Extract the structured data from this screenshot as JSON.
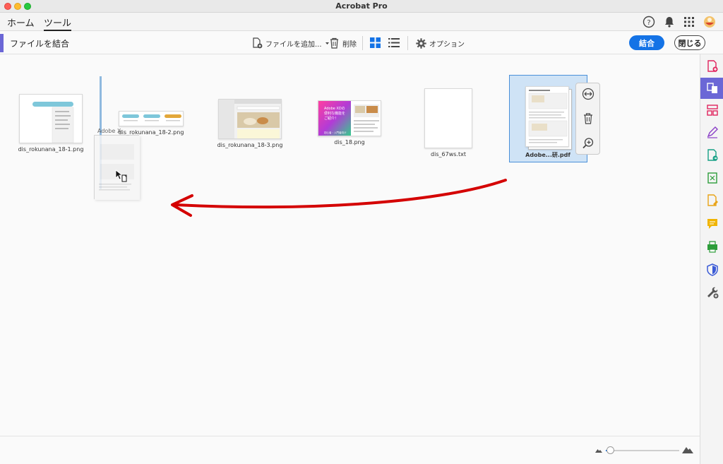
{
  "window": {
    "title": "Acrobat Pro"
  },
  "tabs": [
    {
      "label": "ホーム"
    },
    {
      "label": "ツール"
    }
  ],
  "toolbar": {
    "title": "ファイルを結合",
    "add_files_label": "ファイルを追加...",
    "delete_label": "削除",
    "options_label": "オプション",
    "combine_label": "結合",
    "close_label": "閉じる"
  },
  "thumbnail_text": {
    "xd_line1": "Adobe XDの",
    "xd_line2": "便利な機能を",
    "xd_line3": "ご紹介！",
    "xd_footer": "初心者・入門者向け"
  },
  "files": [
    {
      "name": "dis_rokunana_18-1.png"
    },
    {
      "name": "dis_rokunana_18-2.png"
    },
    {
      "name": "dis_rokunana_18-3.png"
    },
    {
      "name": "dis_18.png"
    },
    {
      "name": "dis_67ws.txt"
    },
    {
      "name": "Adobe...研.pdf",
      "selected": true
    }
  ],
  "drag": {
    "ghost_label": "Adobe X"
  },
  "colors": {
    "accent": "#1473e6",
    "tool_accent": "#6b67d6",
    "annotation_red": "#d40000",
    "selection": "#cfe3f6"
  },
  "zoom": {
    "level": 0.06
  }
}
